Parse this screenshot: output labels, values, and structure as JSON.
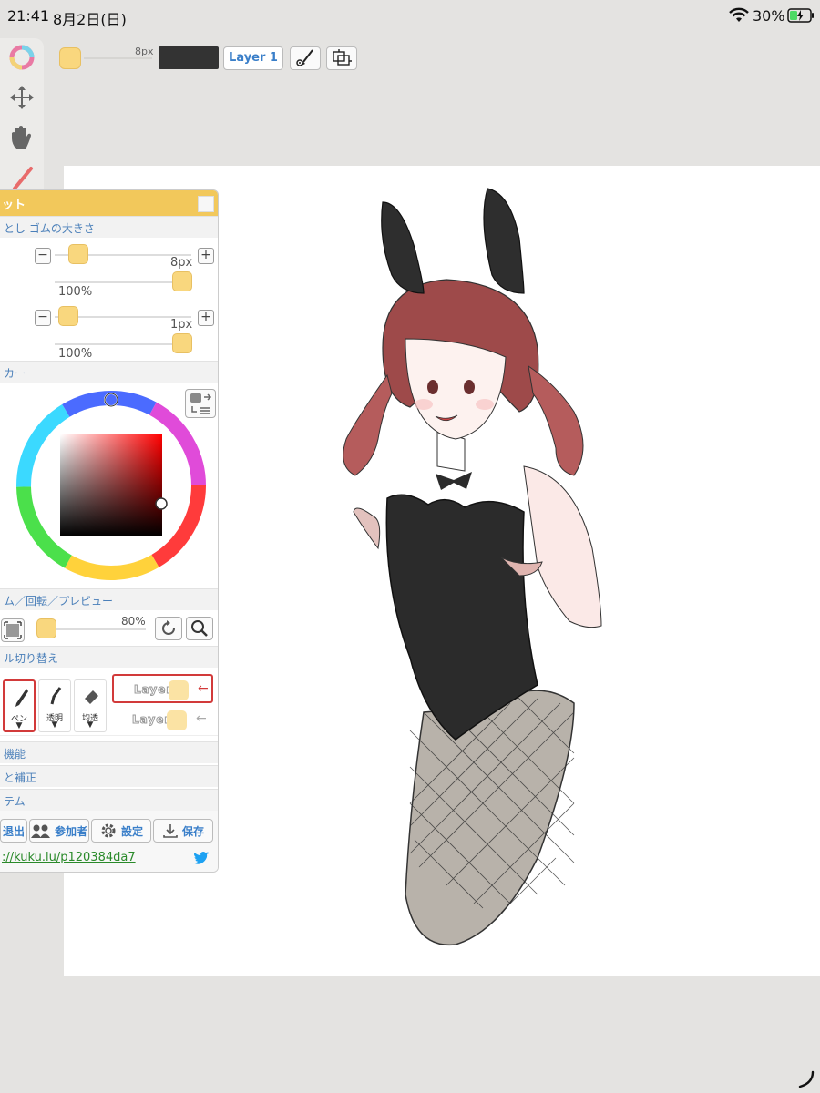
{
  "status": {
    "time": "21:41",
    "date": "8月2日(日)",
    "battery": "30%"
  },
  "toolbar": {
    "brush_size": "8px",
    "layer_button": "Layer 1",
    "accent": "#f9d77e"
  },
  "left_tools": {
    "pen_label": "ペン",
    "transparent_label": "透明",
    "blend_label": "均透"
  },
  "panel": {
    "title": "ット",
    "sections": {
      "size": "とし ゴムの大きさ",
      "color": "カー",
      "zoom": "ム／回転／プレビュー",
      "tool_switch": "ル切り替え",
      "func": "機能",
      "correct": "と補正",
      "system": "テム"
    },
    "pen": {
      "size": "8px",
      "opacity": "100%"
    },
    "eraser": {
      "size": "1px",
      "opacity": "100%"
    },
    "zoom_value": "80%",
    "tool_cards": [
      {
        "name": "ペン",
        "arrow": "▼"
      },
      {
        "name": "透明",
        "arrow": "▼"
      },
      {
        "name": "均透",
        "arrow": "▼"
      }
    ],
    "layers": [
      {
        "name": "Layer1",
        "arrow": "←"
      },
      {
        "name": "Layer2",
        "arrow": "←"
      }
    ],
    "buttons": {
      "exit": "退出",
      "members": "参加者",
      "settings": "設定",
      "save": "保存"
    },
    "url": "://kuku.lu/p120384da7"
  }
}
